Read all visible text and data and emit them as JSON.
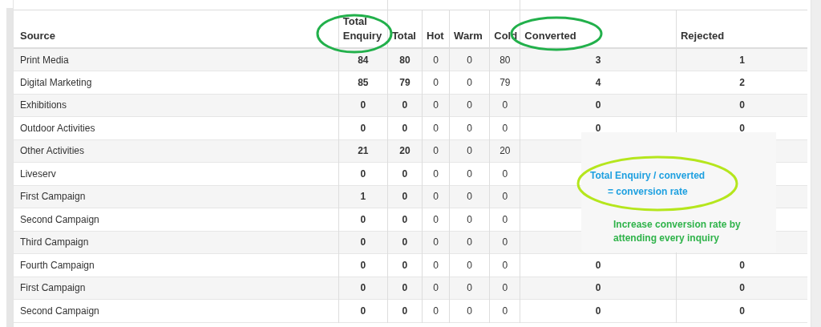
{
  "table": {
    "columns": [
      "Source",
      "Total Enquiry",
      "Total",
      "Hot",
      "Warm",
      "Cold",
      "Converted",
      "Rejected"
    ],
    "rows": [
      [
        "Print Media",
        "84",
        "80",
        "0",
        "0",
        "80",
        "3",
        "1"
      ],
      [
        "Digital Marketing",
        "85",
        "79",
        "0",
        "0",
        "79",
        "4",
        "2"
      ],
      [
        "Exhibitions",
        "0",
        "0",
        "0",
        "0",
        "0",
        "0",
        "0"
      ],
      [
        "Outdoor Activities",
        "0",
        "0",
        "0",
        "0",
        "0",
        "0",
        "0"
      ],
      [
        "Other Activities",
        "21",
        "20",
        "0",
        "0",
        "20",
        null,
        null
      ],
      [
        "Liveserv",
        "0",
        "0",
        "0",
        "0",
        "0",
        null,
        null
      ],
      [
        "First Campaign",
        "1",
        "0",
        "0",
        "0",
        "0",
        null,
        null
      ],
      [
        "Second Campaign",
        "0",
        "0",
        "0",
        "0",
        "0",
        null,
        null
      ],
      [
        "Third Campaign",
        "0",
        "0",
        "0",
        "0",
        "0",
        null,
        null
      ],
      [
        "Fourth Campaign",
        "0",
        "0",
        "0",
        "0",
        "0",
        "0",
        "0"
      ],
      [
        "First Campaign",
        "0",
        "0",
        "0",
        "0",
        "0",
        "0",
        "0"
      ],
      [
        "Second Campaign",
        "0",
        "0",
        "0",
        "0",
        "0",
        "0",
        "0"
      ]
    ]
  },
  "annotation": {
    "formula": [
      "Total Enquiry / converted",
      "= conversion rate"
    ],
    "note": "Increase conversion rate by attending every inquiry"
  }
}
